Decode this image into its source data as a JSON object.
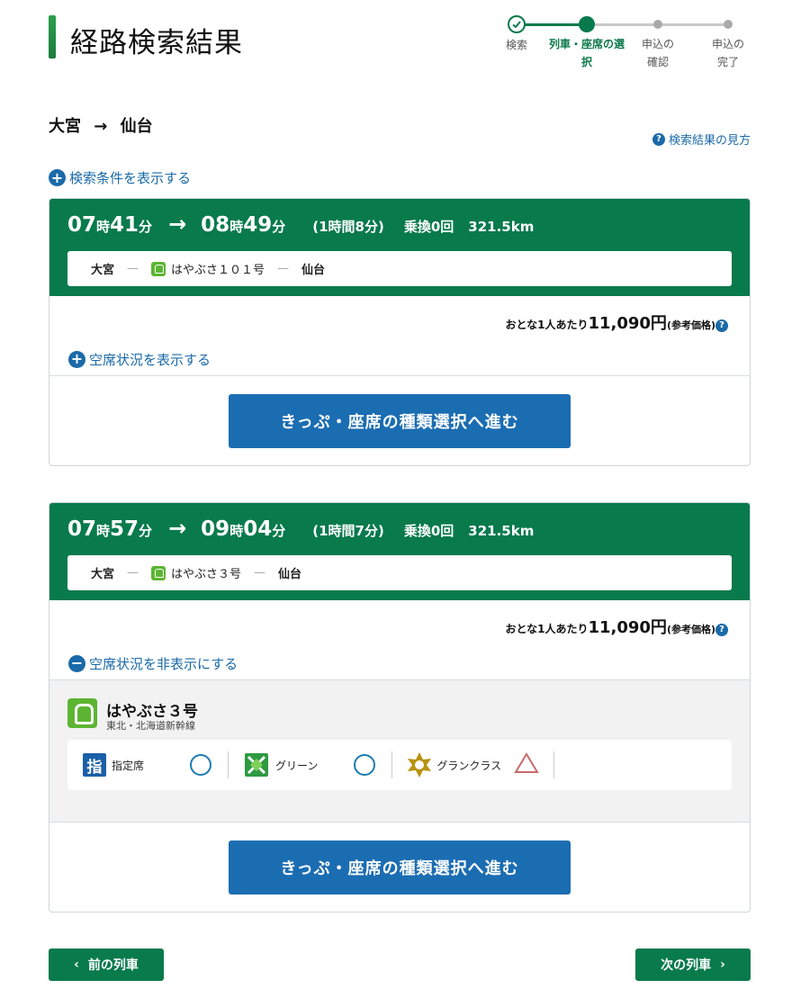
{
  "header": {
    "title": "経路検索結果"
  },
  "steps": [
    {
      "label": "検索",
      "state": "done"
    },
    {
      "label": "列車・座席の選択",
      "state": "active"
    },
    {
      "label": "申込の確認",
      "state": "todo"
    },
    {
      "label": "申込の完了",
      "state": "todo"
    }
  ],
  "route": {
    "from": "大宮",
    "arrow": "→",
    "to": "仙台"
  },
  "help_link": "検索結果の見方",
  "show_conditions": "検索条件を表示する",
  "results": [
    {
      "dep_h": "07",
      "dep_m": "41",
      "arr_h": "08",
      "arr_m": "49",
      "hour_unit": "時",
      "min_unit": "分",
      "duration": "(1時間8分)",
      "transfers": "乗換0回",
      "distance": "321.5km",
      "from": "大宮",
      "train": "はやぶさ１０１号",
      "to": "仙台",
      "price_prefix": "おとな1人あたり",
      "price": "11,090円",
      "price_note": "(参考価格)",
      "toggle": "空席状況を表示する",
      "proceed": "きっぷ・座席の種類選択へ進む"
    },
    {
      "dep_h": "07",
      "dep_m": "57",
      "arr_h": "09",
      "arr_m": "04",
      "hour_unit": "時",
      "min_unit": "分",
      "duration": "(1時間7分)",
      "transfers": "乗換0回",
      "distance": "321.5km",
      "from": "大宮",
      "train": "はやぶさ３号",
      "to": "仙台",
      "price_prefix": "おとな1人あたり",
      "price": "11,090円",
      "price_note": "(参考価格)",
      "toggle": "空席状況を非表示にする",
      "availability": {
        "train_name": "はやぶさ３号",
        "line": "東北・北海道新幹線",
        "seats": [
          {
            "icon": "指",
            "label": "指定席",
            "status": "available"
          },
          {
            "label": "グリーン",
            "status": "available"
          },
          {
            "label": "グランクラス",
            "status": "few"
          }
        ]
      },
      "proceed": "きっぷ・座席の種類選択へ進む"
    }
  ],
  "nav": {
    "prev": "前の列車",
    "next": "次の列車"
  },
  "colors": {
    "brand_green": "#087a4c",
    "link_blue": "#1a6aa8",
    "button_blue": "#1b6db2"
  }
}
